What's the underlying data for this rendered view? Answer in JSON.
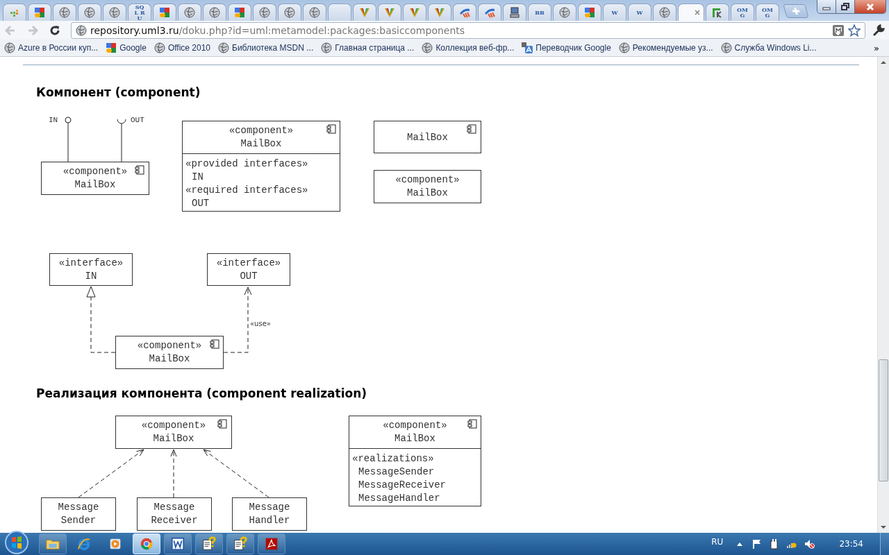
{
  "tabs": [
    {
      "kind": "apps",
      "selected": false
    },
    {
      "kind": "google",
      "selected": false
    },
    {
      "kind": "globe",
      "selected": false
    },
    {
      "kind": "globe",
      "selected": false
    },
    {
      "kind": "globe",
      "selected": false
    },
    {
      "kind": "letters",
      "glyph": "SQL RU",
      "selected": false
    },
    {
      "kind": "google",
      "selected": false
    },
    {
      "kind": "globe",
      "selected": false
    },
    {
      "kind": "globe",
      "selected": false
    },
    {
      "kind": "google",
      "selected": false
    },
    {
      "kind": "globe",
      "selected": false
    },
    {
      "kind": "globe",
      "selected": false
    },
    {
      "kind": "globe",
      "selected": false
    },
    {
      "kind": "blank",
      "selected": false
    },
    {
      "kind": "v",
      "selected": false
    },
    {
      "kind": "v",
      "selected": false
    },
    {
      "kind": "v",
      "selected": false
    },
    {
      "kind": "v",
      "selected": false
    },
    {
      "kind": "swoosh",
      "selected": false
    },
    {
      "kind": "swoosh",
      "selected": false
    },
    {
      "kind": "computer",
      "selected": false
    },
    {
      "kind": "letters",
      "glyph": "BB",
      "selected": false
    },
    {
      "kind": "globe",
      "selected": false
    },
    {
      "kind": "google",
      "selected": false
    },
    {
      "kind": "letters",
      "glyph": "W",
      "selected": false
    },
    {
      "kind": "letters",
      "glyph": "W",
      "selected": false
    },
    {
      "kind": "globe",
      "selected": false
    },
    {
      "kind": "blank",
      "selected": true
    },
    {
      "kind": "ik",
      "selected": false
    },
    {
      "kind": "letters",
      "glyph": "OMG",
      "selected": false
    },
    {
      "kind": "letters",
      "glyph": "OMG",
      "selected": false
    }
  ],
  "address": {
    "host": "repository.uml3.ru",
    "path": "/doku.php?id=uml:metamodel:packages:basiccomponents"
  },
  "bookmarks": [
    {
      "kind": "globe",
      "label": "Azure в России куп..."
    },
    {
      "kind": "google",
      "label": "Google"
    },
    {
      "kind": "globe",
      "label": "Office 2010"
    },
    {
      "kind": "globe",
      "label": "Библиотека MSDN ..."
    },
    {
      "kind": "globe",
      "label": "Главная страница ..."
    },
    {
      "kind": "globe",
      "label": "Коллекция веб-фр..."
    },
    {
      "kind": "translate",
      "label": "Переводчик Google"
    },
    {
      "kind": "globe",
      "label": "Рекомендуемые уз..."
    },
    {
      "kind": "globe",
      "label": "Служба Windows Li..."
    }
  ],
  "bookmarks_more": "»",
  "component_section": {
    "heading": "Компонент (component)",
    "ports_notation": {
      "stereotype": "«component»",
      "name": "MailBox",
      "provided": "IN",
      "required": "OUT"
    },
    "compartment_notation": {
      "stereotype": "«component»",
      "name": "MailBox",
      "groups": [
        {
          "keyword": "«provided interfaces»",
          "items": [
            "IN"
          ]
        },
        {
          "keyword": "«required interfaces»",
          "items": [
            "OUT"
          ]
        }
      ]
    },
    "icon_notation": {
      "name": "MailBox"
    },
    "keyword_notation": {
      "stereotype": "«component»",
      "name": "MailBox"
    },
    "interfaces": [
      {
        "stereotype": "«interface»",
        "name": "IN"
      },
      {
        "stereotype": "«interface»",
        "name": "OUT"
      }
    ],
    "using_component": {
      "stereotype": "«component»",
      "name": "MailBox"
    },
    "use_label": "«use»"
  },
  "realization_section": {
    "heading": "Реализация компонента (component realization)",
    "component": {
      "stereotype": "«component»",
      "name": "MailBox"
    },
    "realizers": [
      {
        "lines": [
          "Message",
          "Sender"
        ]
      },
      {
        "lines": [
          "Message",
          "Receiver"
        ]
      },
      {
        "lines": [
          "Message",
          "Handler"
        ]
      }
    ],
    "compartment_notation": {
      "stereotype": "«component»",
      "name": "MailBox",
      "groups": [
        {
          "keyword": "«realizations»",
          "items": [
            "MessageSender",
            "MessageReceiver",
            "MessageHandler"
          ]
        }
      ]
    }
  },
  "taskbar": {
    "apps": [
      {
        "kind": "folder",
        "selected": false
      },
      {
        "kind": "ie",
        "selected": false
      },
      {
        "kind": "media",
        "selected": false
      },
      {
        "kind": "chrome",
        "selected": true
      },
      {
        "kind": "word",
        "selected": false
      },
      {
        "kind": "help",
        "selected": false
      },
      {
        "kind": "help",
        "selected": false
      },
      {
        "kind": "pdf",
        "selected": false
      }
    ],
    "language": "RU",
    "clock": "23:54"
  }
}
